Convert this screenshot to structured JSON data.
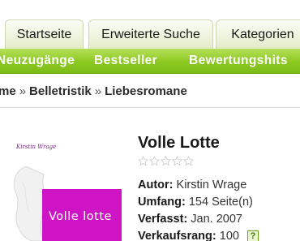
{
  "tabs": [
    {
      "label": "Startseite"
    },
    {
      "label": "Erweiterte Suche"
    },
    {
      "label": "Kategorien"
    }
  ],
  "nav": [
    {
      "label": "Neuzugänge"
    },
    {
      "label": "Bestseller"
    },
    {
      "label": "Bewertungshits"
    }
  ],
  "breadcrumb": {
    "items": [
      "Home",
      "Belletristik",
      "Liebesromane"
    ],
    "separator": "»"
  },
  "book": {
    "title": "Volle Lotte",
    "rating": {
      "stars_total": 5,
      "stars_filled": 0
    },
    "cover": {
      "author_text": "Kirstin Wrage",
      "title_text": "Volle lotte",
      "band_color": "#cf14c6"
    },
    "details": [
      {
        "key": "Autor:",
        "value": "Kirstin Wrage"
      },
      {
        "key": "Umfang:",
        "value": "154 Seite(n)"
      },
      {
        "key": "Verfasst:",
        "value": "Jan. 2007"
      },
      {
        "key": "Verkaufsrang:",
        "value": "100"
      }
    ],
    "rank_help_icon": "question-icon",
    "rank_help_glyph": "?"
  },
  "colors": {
    "nav_green": "#8cc820",
    "tab_bg": "#e3ecca",
    "text_dark": "#1a1a1a",
    "cover_purple": "#cf14c6"
  }
}
